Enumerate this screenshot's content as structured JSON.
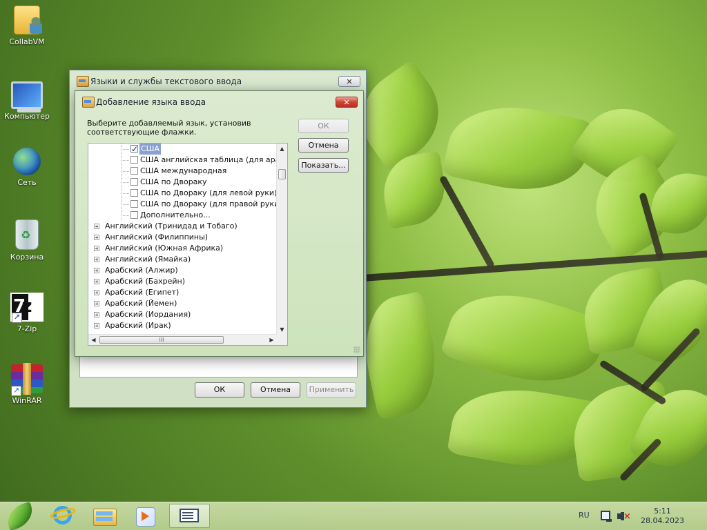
{
  "desktop": {
    "icons": [
      {
        "label": "CollabVM"
      },
      {
        "label": "Компьютер"
      },
      {
        "label": "Сеть"
      },
      {
        "label": "Корзина"
      },
      {
        "label": "7-Zip"
      },
      {
        "label": "WinRAR"
      }
    ]
  },
  "outer_window": {
    "title": "Языки и службы текстового ввода",
    "buttons": {
      "ok": "ОК",
      "cancel": "Отмена",
      "apply": "Применить"
    }
  },
  "dialog": {
    "title": "Добавление языка ввода",
    "instruction": "Выберите добавляемый язык, установив соответствующие флажки.",
    "buttons": {
      "ok": "ОК",
      "cancel": "Отмена",
      "preview": "Показать..."
    },
    "subitems": [
      {
        "label": "США",
        "checked": true
      },
      {
        "label": "США английская таблица (для арабск",
        "checked": false
      },
      {
        "label": "США международная",
        "checked": false
      },
      {
        "label": "США по Двораку",
        "checked": false
      },
      {
        "label": "США по Двораку (для левой руки)",
        "checked": false
      },
      {
        "label": "США по Двораку (для правой руки)",
        "checked": false
      },
      {
        "label": "Дополнительно...",
        "checked": false
      }
    ],
    "languages": [
      {
        "label": "Английский (Тринидад и Тобаго)"
      },
      {
        "label": "Английский (Филиппины)"
      },
      {
        "label": "Английский (Южная Африка)"
      },
      {
        "label": "Английский (Ямайка)"
      },
      {
        "label": "Арабский (Алжир)"
      },
      {
        "label": "Арабский (Бахрейн)"
      },
      {
        "label": "Арабский (Египет)"
      },
      {
        "label": "Арабский (Йемен)"
      },
      {
        "label": "Арабский (Иордания)"
      },
      {
        "label": "Арабский (Ирак)"
      }
    ],
    "scroll_glyphs": {
      "up": "▲",
      "down": "▼",
      "left": "◀",
      "right": "▶",
      "thumb": "III"
    }
  },
  "taskbar": {
    "language": "RU",
    "time": "5:11",
    "date": "28.04.2023"
  }
}
